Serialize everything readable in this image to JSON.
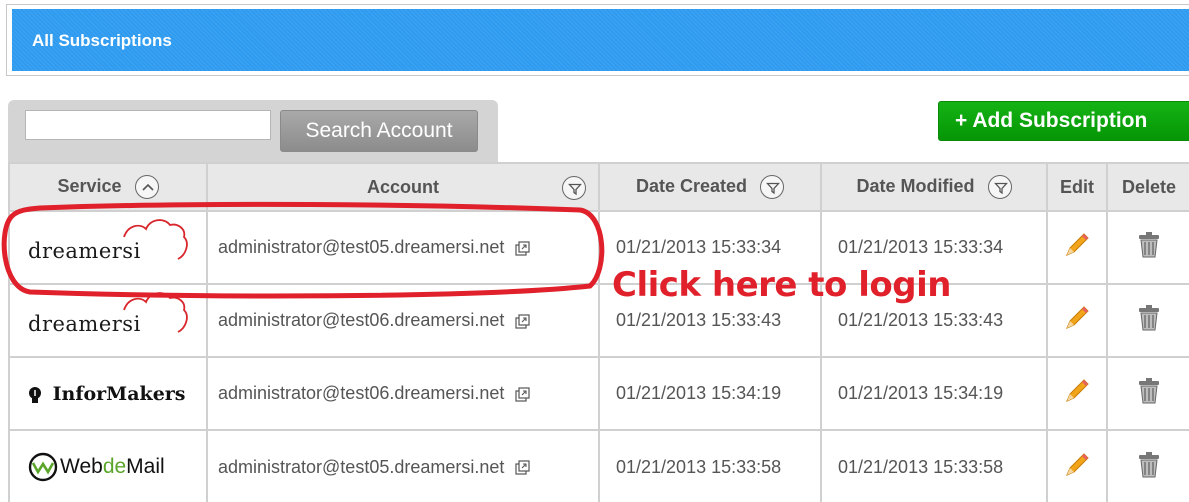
{
  "header": {
    "title": "All Subscriptions"
  },
  "search": {
    "value": "",
    "button_label": "Search Account"
  },
  "toolbar": {
    "add_label": "+ Add Subscription"
  },
  "table": {
    "columns": [
      "Service",
      "Account",
      "Date Created",
      "Date Modified",
      "Edit",
      "Delete"
    ],
    "rows": [
      {
        "service": "dreamersi",
        "service_logo": "dreamersi-logo",
        "account": "administrator@test05.dreamersi.net",
        "created": "01/21/2013 15:33:34",
        "modified": "01/21/2013 15:33:34"
      },
      {
        "service": "dreamersi",
        "service_logo": "dreamersi-logo",
        "account": "administrator@test06.dreamersi.net",
        "created": "01/21/2013 15:33:43",
        "modified": "01/21/2013 15:33:43"
      },
      {
        "service": "InforMakers",
        "service_logo": "informakers-logo",
        "account": "administrator@test06.dreamersi.net",
        "created": "01/21/2013 15:34:19",
        "modified": "01/21/2013 15:34:19"
      },
      {
        "service_prefix": "Web",
        "service_accent": "de",
        "service_suffix": "Mail",
        "service_logo": "webdemail-logo",
        "account": "administrator@test05.dreamersi.net",
        "created": "01/21/2013 15:33:58",
        "modified": "01/21/2013 15:33:58"
      }
    ]
  },
  "annotation": {
    "text": "Click here to login",
    "color": "#e0202a"
  },
  "icons": {
    "sort": "sort-up-icon",
    "filter": "filter-icon",
    "popout": "external-link-icon",
    "edit": "pencil-icon",
    "delete": "trash-icon"
  },
  "colors": {
    "header": "#2f9bf0",
    "add_button": "#0a9f0a",
    "annotation": "#e0202a"
  }
}
